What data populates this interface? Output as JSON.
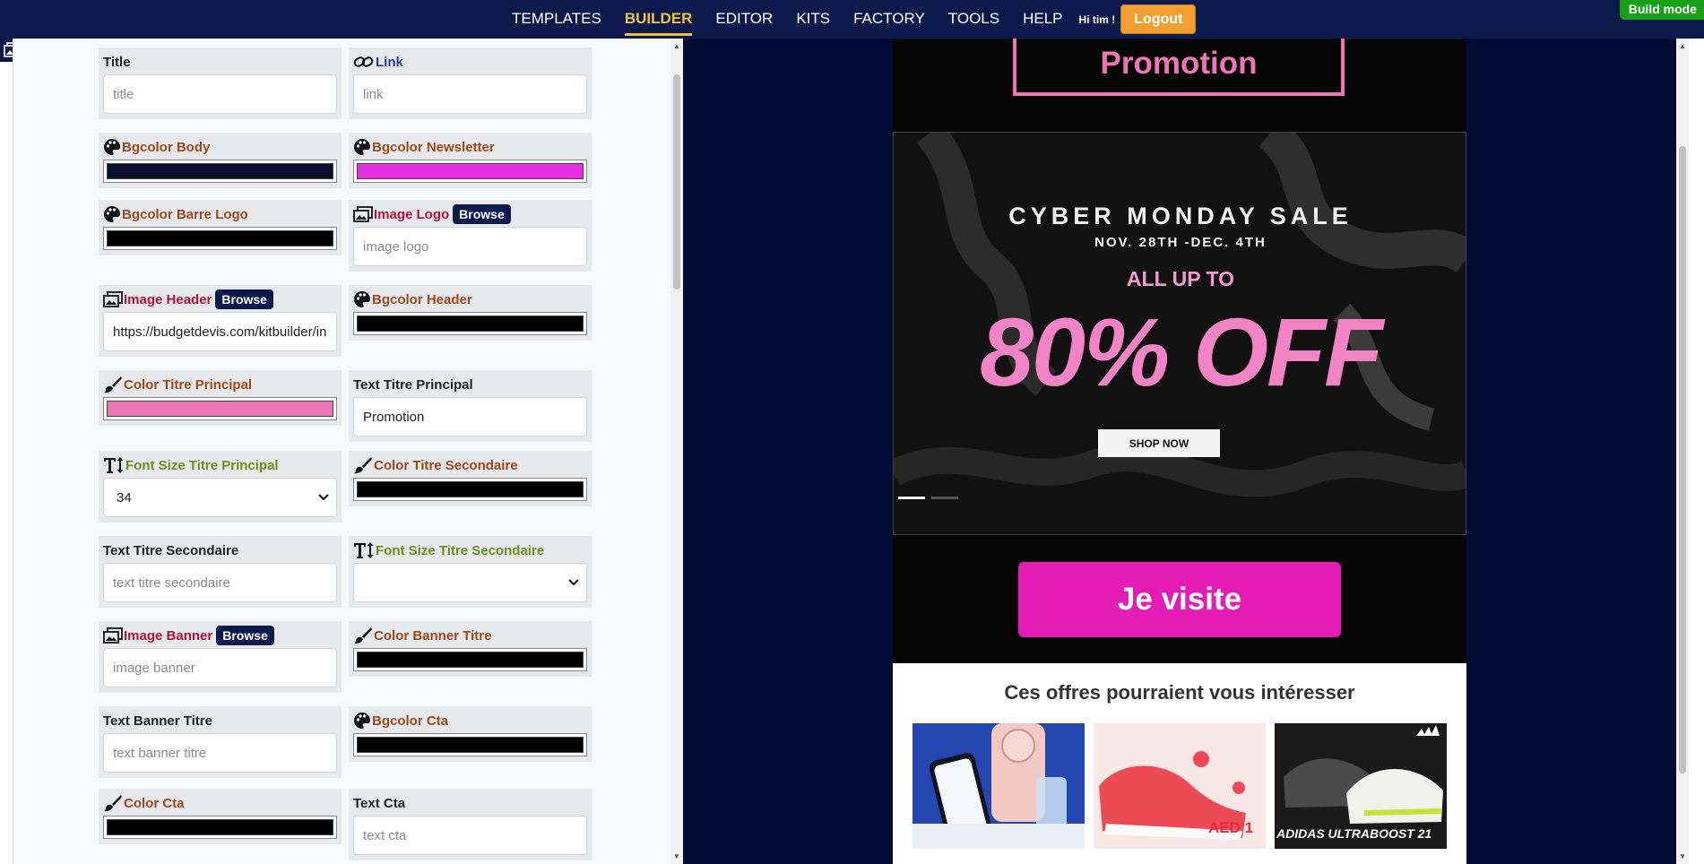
{
  "nav": {
    "links": [
      "TEMPLATES",
      "BUILDER",
      "EDITOR",
      "KITS",
      "FACTORY",
      "TOOLS",
      "HELP"
    ],
    "active": "BUILDER",
    "greeting": "Hi tim !",
    "logout_label": "Logout",
    "build_mode_label": "Build mode"
  },
  "form": {
    "title": {
      "label": "Title",
      "placeholder": "title"
    },
    "link": {
      "label": "Link",
      "placeholder": "link"
    },
    "bgcolor_body": {
      "label": "Bgcolor Body",
      "color": "#0b0e2c"
    },
    "bgcolor_newsletter": {
      "label": "Bgcolor Newsletter",
      "color": "#e52ce0"
    },
    "bgcolor_barre_logo": {
      "label": "Bgcolor Barre Logo",
      "color": "#000000"
    },
    "image_logo": {
      "label": "Image Logo",
      "browse_label": "Browse",
      "placeholder": "image logo"
    },
    "image_header": {
      "label": "Image Header",
      "browse_label": "Browse",
      "value": "https://budgetdevis.com/kitbuilder/in"
    },
    "bgcolor_header": {
      "label": "Bgcolor Header",
      "color": "#000000"
    },
    "color_titre_principal": {
      "label": "Color Titre Principal",
      "color": "#ee74b6"
    },
    "text_titre_principal": {
      "label": "Text Titre Principal",
      "value": "Promotion"
    },
    "font_size_titre_principal": {
      "label": "Font Size Titre Principal",
      "value": "34"
    },
    "color_titre_secondaire": {
      "label": "Color Titre Secondaire",
      "color": "#000000"
    },
    "text_titre_secondaire": {
      "label": "Text Titre Secondaire",
      "placeholder": "text titre secondaire"
    },
    "font_size_titre_secondaire": {
      "label": "Font Size Titre Secondaire",
      "value": ""
    },
    "image_banner": {
      "label": "Image Banner",
      "browse_label": "Browse",
      "placeholder": "image banner"
    },
    "color_banner_titre": {
      "label": "Color Banner Titre",
      "color": "#000000"
    },
    "text_banner_titre": {
      "label": "Text Banner Titre",
      "placeholder": "text banner titre"
    },
    "bgcolor_cta": {
      "label": "Bgcolor Cta",
      "color": "#000000"
    },
    "color_cta": {
      "label": "Color Cta",
      "color": "#000000"
    },
    "text_cta": {
      "label": "Text Cta",
      "placeholder": "text cta"
    }
  },
  "preview": {
    "title": "Promotion",
    "banner": {
      "line1": "CYBER MONDAY SALE",
      "line2": "NOV. 28TH -DEC. 4TH",
      "line3": "ALL UP TO",
      "line4": "80% OFF",
      "button": "SHOP NOW"
    },
    "cta_label": "Je visite",
    "offers_title": "Ces offres pourraient vous intéresser",
    "offer_images": [
      {
        "name": "phone-app-offer",
        "caption": ""
      },
      {
        "name": "red-sneakers-offer",
        "caption": "AED 1"
      },
      {
        "name": "adidas-ultraboost-offer",
        "caption": "ADIDAS ULTRABOOST 21"
      }
    ]
  },
  "colors": {
    "nav_bg": "#0c1a4b",
    "accent": "#f0c244",
    "logout": "#f0a030",
    "build_mode": "#19a019",
    "preview_bg": "#000a33",
    "cta": "#e21cb4",
    "promo_pink": "#ee74b6"
  }
}
